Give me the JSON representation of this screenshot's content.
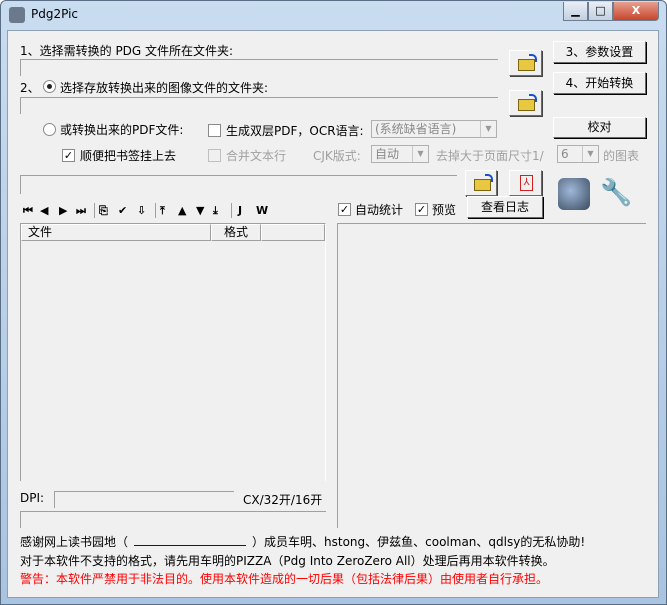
{
  "window": {
    "title": "Pdg2Pic",
    "minimize": "▁",
    "maximize": "□",
    "close": "X"
  },
  "step1_label": "1、选择需转换的 PDG 文件所在文件夹:",
  "step2_prefix": "2、",
  "step2_label": "选择存放转换出来的图像文件的文件夹:",
  "pdf_label": "或转换出来的PDF文件:",
  "dual_layer_label": "生成双层PDF，OCR语言:",
  "ocr_language": "(系统缺省语言)",
  "bookmark_label": "顺便把书签挂上去",
  "merge_lines_label": "合并文本行",
  "cjk_label": "CJK版式:",
  "cjk_value": "自动",
  "remove_label": "去掉大于页面尺寸1/",
  "remove_value": "6",
  "chart_label": "的图表",
  "buttons": {
    "settings": "3、参数设置",
    "start": "4、开始转换",
    "proofread": "校对",
    "view_log": "查看日志"
  },
  "auto_stat_label": "自动统计",
  "preview_label": "预览",
  "toolbar": [
    "⏮",
    "◀",
    "▶",
    "⏭",
    "⎘",
    "✔",
    "⇩",
    "⤒",
    "▲",
    "▼",
    "⤓",
    "J",
    "W"
  ],
  "list_columns": [
    "文件",
    "格式",
    ""
  ],
  "dpi_label": "DPI:",
  "size_label": "CX/32开/16开",
  "credits_pre": "感谢网上读书园地（",
  "credits_post": "）成员车明、hstong、伊兹鱼、coolman、qdlsy的无私协助!",
  "note": "对于本软件不支持的格式，请先用车明的PIZZA（Pdg Into ZeroZero All）处理后再用本软件转换。",
  "warning": "警告：本软件严禁用于非法目的。使用本软件造成的一切后果（包括法律后果）由使用者自行承担。",
  "colors": {
    "warning": "#ff0000",
    "link": "#0000ff"
  }
}
